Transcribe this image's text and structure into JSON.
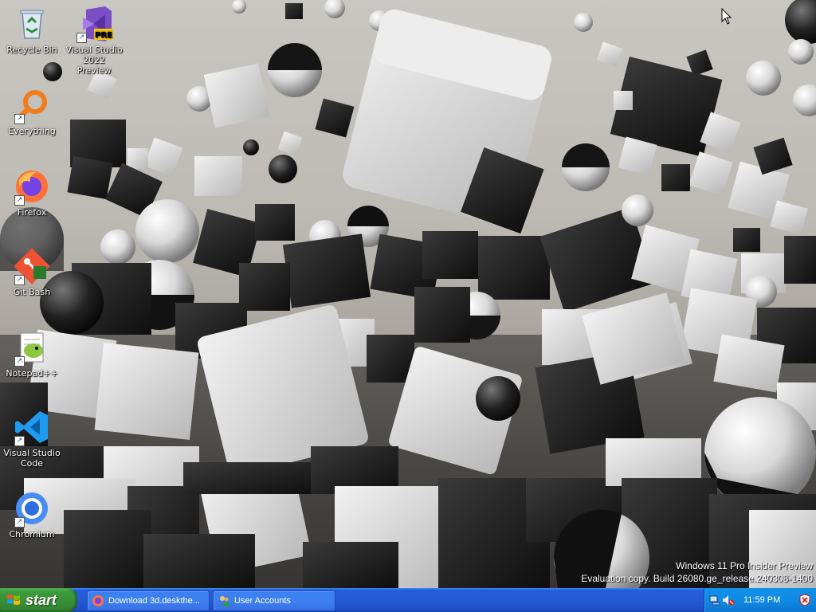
{
  "desktop": {
    "icons": [
      {
        "label": "Recycle Bin",
        "icon": "recycle-bin-icon"
      },
      {
        "label": "Visual Studio 2022 Preview",
        "icon": "visual-studio-preview-icon",
        "badge": "PRE"
      },
      {
        "label": "Everything",
        "icon": "everything-search-icon"
      },
      {
        "label": "Firefox",
        "icon": "firefox-icon"
      },
      {
        "label": "Git Bash",
        "icon": "git-bash-icon"
      },
      {
        "label": "Notepad++",
        "icon": "notepad-plus-plus-icon"
      },
      {
        "label": "Visual Studio Code",
        "icon": "vscode-icon"
      },
      {
        "label": "Chromium",
        "icon": "chromium-icon"
      }
    ],
    "watermark": {
      "line1": "Windows 11 Pro Insider Preview",
      "line2": "Evaluation copy. Build 26080.ge_release.240308-1400"
    }
  },
  "taskbar": {
    "start_label": "start",
    "tasks": [
      {
        "label": "Download 3d.deskthe...",
        "icon": "firefox-icon"
      },
      {
        "label": "User Accounts",
        "icon": "user-accounts-icon"
      }
    ],
    "tray": {
      "clock": "11:59 PM",
      "icons": [
        "network-icon",
        "volume-muted-icon",
        "shield-icon"
      ]
    }
  },
  "colors": {
    "taskbar_blue": "#245edc",
    "start_green": "#3c9c3a",
    "tray_blue": "#0f8be6"
  }
}
